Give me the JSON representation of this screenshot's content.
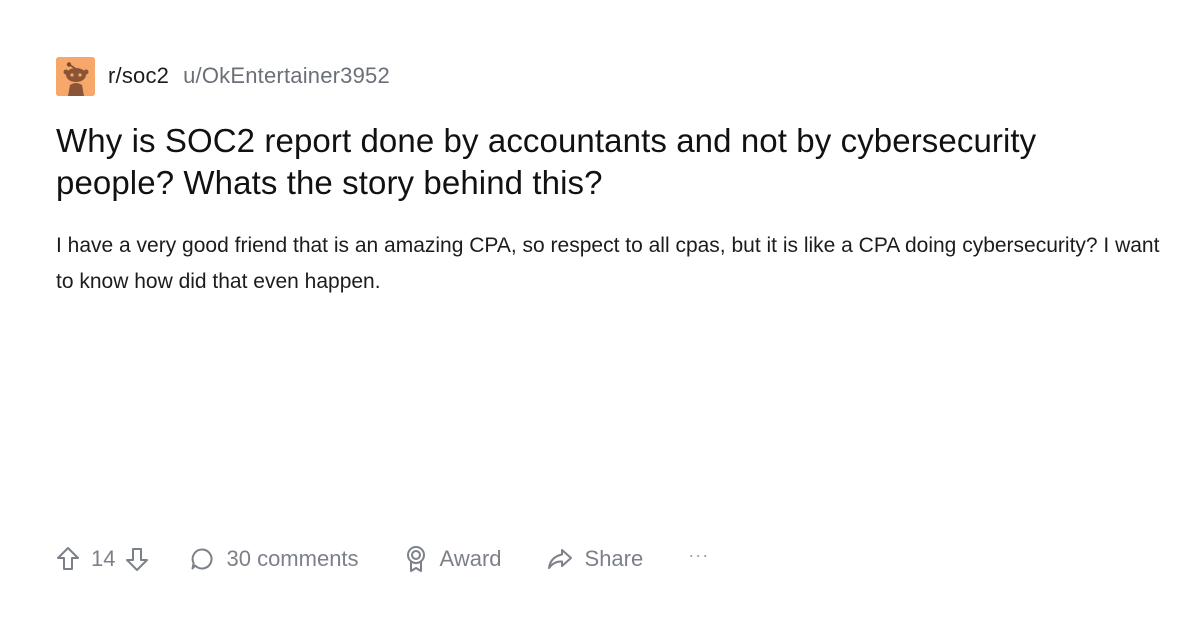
{
  "post": {
    "subreddit": "r/soc2",
    "author": "u/OkEntertainer3952",
    "title": "Why is SOC2 report done by accountants and not by cybersecurity people? Whats the story behind this?",
    "body": "I have a very good friend that is an amazing CPA, so respect to all cpas, but it is like a CPA doing cybersecurity? I want to know how did that even happen."
  },
  "actions": {
    "vote_count": "14",
    "comments_label": "30 comments",
    "award_label": "Award",
    "share_label": "Share",
    "more_label": "···"
  },
  "icons": {
    "avatar": "snoo-avatar-icon",
    "upvote": "upvote-arrow-icon",
    "downvote": "downvote-arrow-icon",
    "comments": "comment-bubble-icon",
    "award": "award-ribbon-icon",
    "share": "share-arrow-icon"
  },
  "colors": {
    "avatar_background": "#f7a76a",
    "muted_text": "#7c8189",
    "primary_text": "#111111"
  }
}
